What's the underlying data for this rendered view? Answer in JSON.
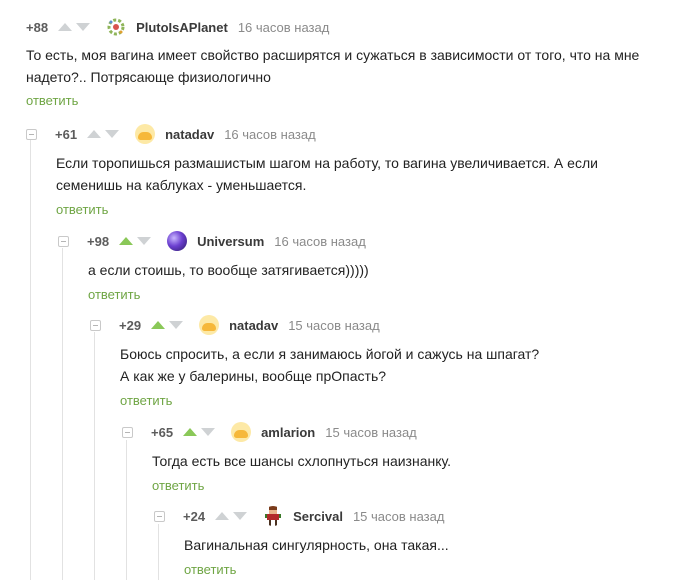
{
  "comments": [
    {
      "rating": "+88",
      "nick": "PlutoIsAPlanet",
      "time": "16 часов назад",
      "text": "То есть, моя вагина имеет свойство расширятся и сужаться в зависимости от того, что на мне надето?.. Потрясающе физиологично",
      "reply": "ответить",
      "avatar_icon": "gear-avatar-icon",
      "upvote_active": false
    },
    {
      "rating": "+61",
      "nick": "natadav",
      "time": "16 часов назад",
      "text": "Если торопишься размашистым шагом на работу, то вагина увеличивается. А если семенишь на каблуках - уменьшается.",
      "reply": "ответить",
      "avatar_icon": "smiley-avatar-icon",
      "upvote_active": false
    },
    {
      "rating": "+98",
      "nick": "Universum",
      "time": "16 часов назад",
      "text": "а если стоишь, то вообще затягивается)))))",
      "reply": "ответить",
      "avatar_icon": "planet-avatar-icon",
      "upvote_active": true
    },
    {
      "rating": "+29",
      "nick": "natadav",
      "time": "15 часов назад",
      "text_line1": "Боюсь спросить, а если я занимаюсь йогой и сажусь на шпагат?",
      "text_line2": "А как же у балерины, вообще прОпасть?",
      "reply": "ответить",
      "avatar_icon": "smiley-avatar-icon",
      "upvote_active": true
    },
    {
      "rating": "+65",
      "nick": "amlarion",
      "time": "15 часов назад",
      "text": "Тогда есть все шансы схлопнуться наизнанку.",
      "reply": "ответить",
      "avatar_icon": "smiley-avatar-icon",
      "upvote_active": true
    },
    {
      "rating": "+24",
      "nick": "Sercival",
      "time": "15 часов назад",
      "text": "Вагинальная сингулярность, она такая...",
      "reply": "ответить",
      "avatar_icon": "pixel-character-avatar-icon",
      "upvote_active": false
    }
  ],
  "colors": {
    "accent_green": "#8ac858",
    "reply_green": "#6fa544",
    "inactive_arrow": "#cfd2d4"
  }
}
